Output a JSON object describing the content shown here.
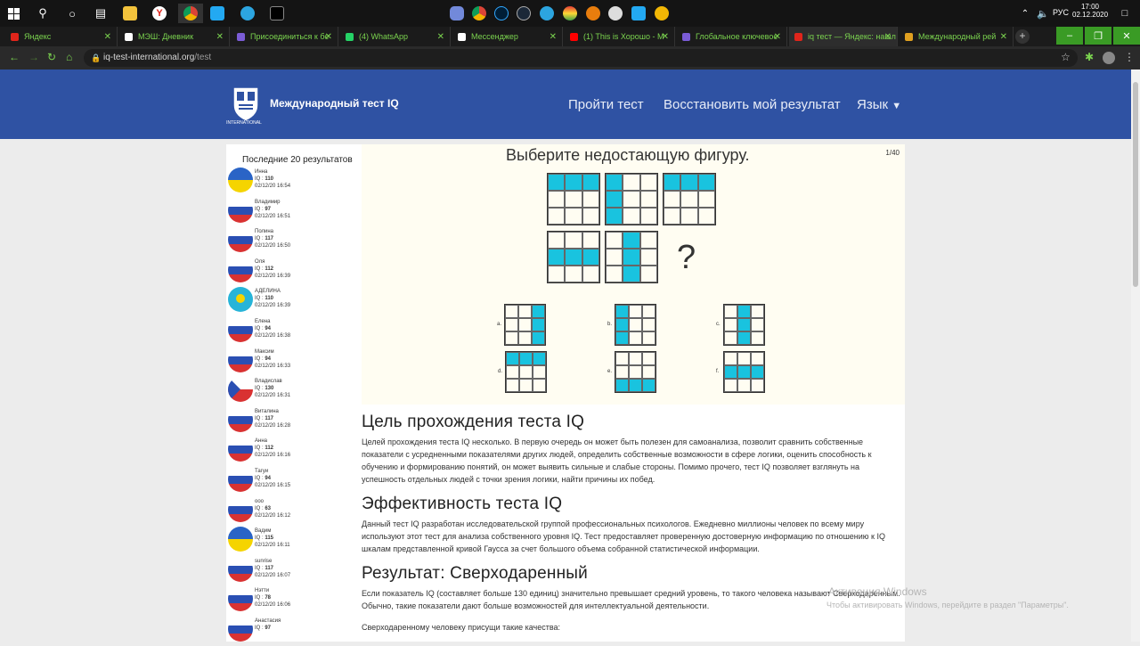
{
  "taskbar": {
    "lang": "РУС",
    "time": "17:00",
    "date": "02.12.2020"
  },
  "tabs": [
    {
      "label": "Яндекс",
      "color": "#e0251b"
    },
    {
      "label": "МЭШ: Дневник",
      "color": "#ffffff"
    },
    {
      "label": "Присоединиться к бе",
      "color": "#7b5cd6"
    },
    {
      "label": "(4) WhatsApp",
      "color": "#25d366"
    },
    {
      "label": "Мессенджер",
      "color": "#ffffff"
    },
    {
      "label": "(1) This is Хорошо - М",
      "color": "#ff0000"
    },
    {
      "label": "Глобальное ключевое",
      "color": "#7b5cd6"
    },
    {
      "label": "iq тест — Яндекс: нашл",
      "color": "#e0251b"
    },
    {
      "label": "Международный рей",
      "color": "#e0a020"
    }
  ],
  "address": {
    "host": "iq-test-international.org",
    "path": "/test"
  },
  "header": {
    "brand": "Международный тест IQ",
    "logo_text": "INTERNATIONAL",
    "menu_take": "Пройти тест",
    "menu_restore": "Восстановить мой результат",
    "menu_lang": "Язык"
  },
  "sidebar": {
    "title": "Последние 20 результатов",
    "iq_label": "IQ :",
    "results": [
      {
        "name": "Инна",
        "iq": "110",
        "date": "02/12/20 16:54",
        "flag": "ua"
      },
      {
        "name": "Владимир",
        "iq": "97",
        "date": "02/12/20 16:51",
        "flag": "ru"
      },
      {
        "name": "Полина",
        "iq": "117",
        "date": "02/12/20 16:50",
        "flag": "ru"
      },
      {
        "name": "Оля",
        "iq": "112",
        "date": "02/12/20 16:39",
        "flag": "ru"
      },
      {
        "name": "АДЕЛИНА",
        "iq": "110",
        "date": "02/12/20 16:39",
        "flag": "kz"
      },
      {
        "name": "Елена",
        "iq": "94",
        "date": "02/12/20 16:38",
        "flag": "ru"
      },
      {
        "name": "Максим",
        "iq": "94",
        "date": "02/12/20 16:33",
        "flag": "ru"
      },
      {
        "name": "Владислав",
        "iq": "130",
        "date": "02/12/20 16:31",
        "flag": "cz"
      },
      {
        "name": "Виталина",
        "iq": "117",
        "date": "02/12/20 16:28",
        "flag": "ru"
      },
      {
        "name": "Анна",
        "iq": "112",
        "date": "02/12/20 16:16",
        "flag": "ru"
      },
      {
        "name": "Тагуи",
        "iq": "94",
        "date": "02/12/20 16:15",
        "flag": "ru"
      },
      {
        "name": "ооо",
        "iq": "63",
        "date": "02/12/20 16:12",
        "flag": "ru"
      },
      {
        "name": "Вадим",
        "iq": "115",
        "date": "02/12/20 16:11",
        "flag": "ua"
      },
      {
        "name": "sunrise",
        "iq": "117",
        "date": "02/12/20 16:07",
        "flag": "ru"
      },
      {
        "name": "Нэтти",
        "iq": "78",
        "date": "02/12/20 16:06",
        "flag": "ru"
      },
      {
        "name": "Анастасия",
        "iq": "97",
        "date": "",
        "flag": "ru"
      }
    ]
  },
  "quiz": {
    "title": "Выберите недостающую фигуру.",
    "counter": "1/40",
    "question_mark": "?",
    "accent_color": "#19c3df",
    "options": [
      {
        "label": "a."
      },
      {
        "label": "b."
      },
      {
        "label": "c."
      },
      {
        "label": "d."
      },
      {
        "label": "e."
      },
      {
        "label": "f."
      }
    ]
  },
  "article": {
    "h1": "Цель прохождения теста IQ",
    "p1": "Целей прохождения теста IQ несколько. В первую очередь он может быть полезен для самоанализа, позволит сравнить собственные показатели с усредненными показателями других людей, определить собственные возможности в сфере логики, оценить способность к обучению и формированию понятий, он может выявить сильные и слабые стороны. Помимо прочего, тест IQ позволяет взглянуть на успешность отдельных людей с точки зрения логики, найти причины их побед.",
    "h2": "Эффективность теста  IQ",
    "p2": "Данный тест IQ разработан исследовательской группой профессиональных психологов. Ежедневно миллионы человек по всему миру используют этот тест для анализа собственного уровня IQ. Тест предоставляет проверенную достоверную информацию по отношению к IQ шкалам представленной кривой Гаусса за счет большого объема собранной статистической информации.",
    "h3": "Результат: Сверходаренный",
    "p3": "Если показатель IQ (составляет больше 130 единиц) значительно превышает средний уровень, то такого человека называют Сверходаренным. Обычно, такие показатели дают больше возможностей для интеллектуальной деятельности.",
    "p4": "Сверходаренному человеку присущи такие качества:"
  },
  "watermark": {
    "line1": "Активация Windows",
    "line2": "Чтобы активировать Windows, перейдите в раздел \"Параметры\"."
  }
}
